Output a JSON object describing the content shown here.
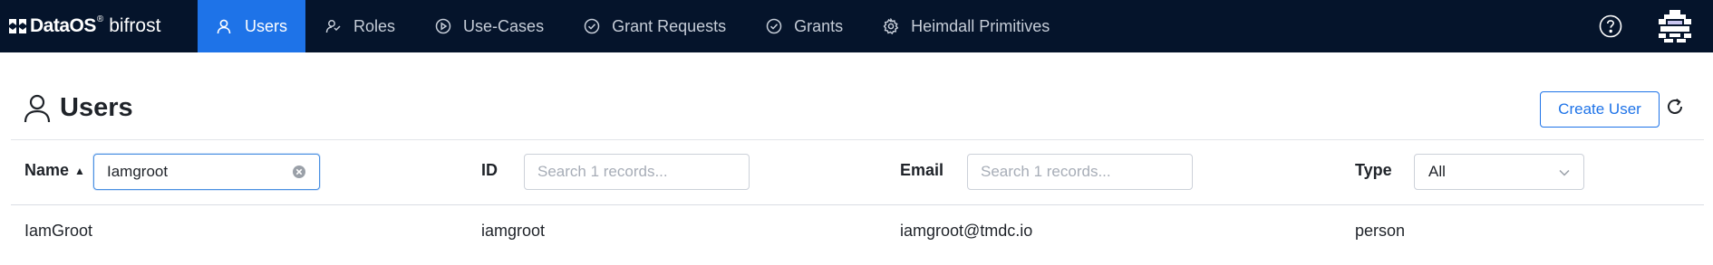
{
  "brand": {
    "name": "DataOS",
    "reg": "®",
    "app": "bifrost"
  },
  "nav": {
    "items": [
      {
        "label": "Users",
        "icon": "user-icon",
        "active": true
      },
      {
        "label": "Roles",
        "icon": "roles-icon",
        "active": false
      },
      {
        "label": "Use-Cases",
        "icon": "play-circle-icon",
        "active": false
      },
      {
        "label": "Grant Requests",
        "icon": "check-circle-icon",
        "active": false
      },
      {
        "label": "Grants",
        "icon": "check-circle-icon",
        "active": false
      },
      {
        "label": "Heimdall Primitives",
        "icon": "gear-icon",
        "active": false
      }
    ]
  },
  "header": {
    "title": "Users",
    "create_label": "Create User"
  },
  "filters": {
    "name_label": "Name",
    "name_value": "Iamgroot",
    "id_label": "ID",
    "id_placeholder": "Search 1 records...",
    "email_label": "Email",
    "email_placeholder": "Search 1 records...",
    "type_label": "Type",
    "type_value": "All"
  },
  "rows": [
    {
      "name": "IamGroot",
      "id": "iamgroot",
      "email": "iamgroot@tmdc.io",
      "type": "person"
    }
  ],
  "colors": {
    "nav_bg": "#05142b",
    "accent": "#1e73e8"
  }
}
